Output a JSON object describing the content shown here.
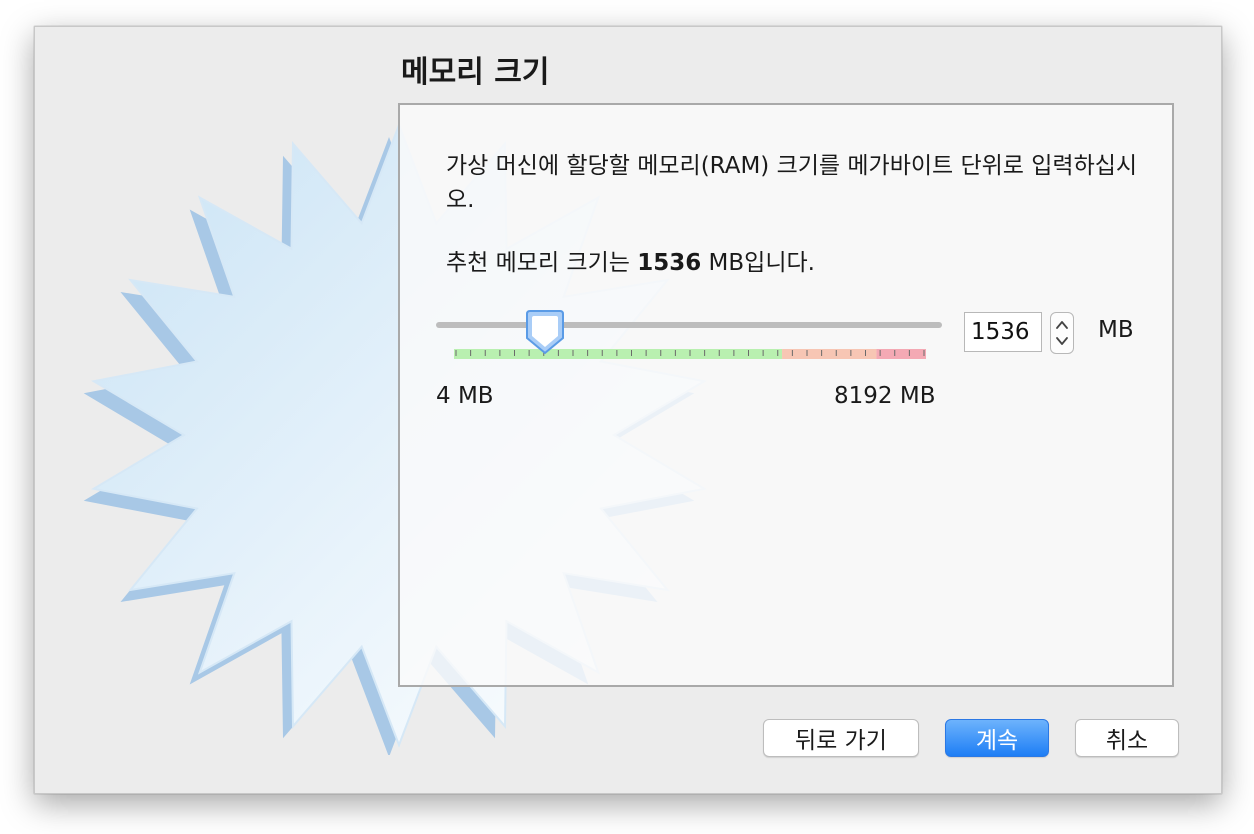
{
  "dialog": {
    "title": "메모리 크기",
    "description": "가상 머신에 할당할 메모리(RAM) 크기를 메가바이트 단위로 입력하십시오.",
    "recommend_prefix": "추천 메모리 크기는 ",
    "recommend_value": "1536",
    "recommend_suffix": " MB입니다.",
    "slider": {
      "min_label": "4 MB",
      "max_label": "8192 MB",
      "min": 4,
      "max": 8192,
      "value": 1536
    },
    "memory_input_value": "1536",
    "unit_label": "MB",
    "buttons": {
      "back": "뒤로 가기",
      "continue": "계속",
      "cancel": "취소"
    }
  },
  "colors": {
    "accent": "#1e7ef5",
    "safe_zone": "#b9f0b0",
    "warning_zone": "#f7c6b4",
    "danger_zone": "#f4a9b4"
  },
  "icons": {
    "background": "starburst-icon",
    "stepper": "stepper-arrows-icon",
    "slider_thumb": "slider-thumb-icon"
  }
}
